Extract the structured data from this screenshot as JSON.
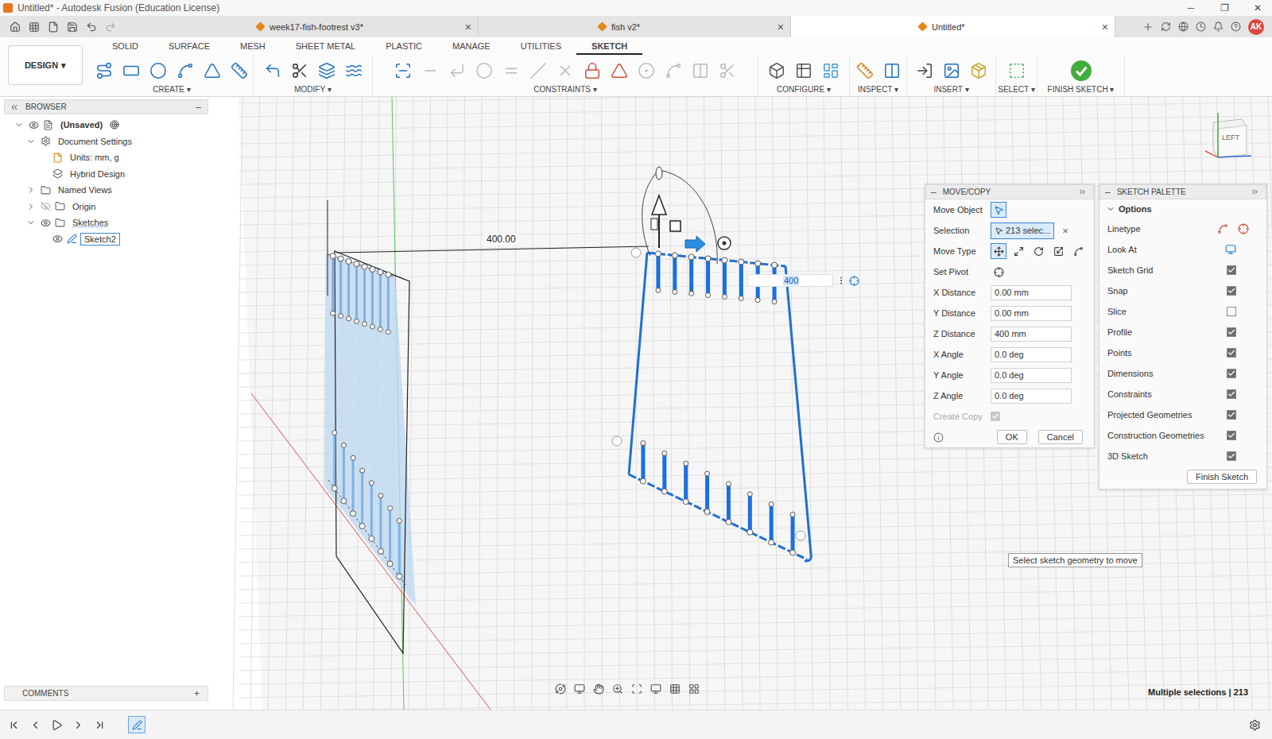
{
  "window": {
    "title": "Untitled* - Autodesk Fusion (Education License)",
    "controls": [
      "─",
      "❐",
      "✕"
    ]
  },
  "doc_tabs": [
    {
      "label": "week17-fish-footrest v3*",
      "selected": false
    },
    {
      "label": "fish v2*",
      "selected": false
    },
    {
      "label": "Untitled*",
      "selected": true
    }
  ],
  "tab_close": "×",
  "account": "AK",
  "workspace": {
    "label": "DESIGN",
    "arrow": "▾"
  },
  "ribbon_tabs": [
    {
      "label": "SOLID",
      "selected": false
    },
    {
      "label": "SURFACE",
      "selected": false
    },
    {
      "label": "MESH",
      "selected": false
    },
    {
      "label": "SHEET METAL",
      "selected": false
    },
    {
      "label": "PLASTIC",
      "selected": false
    },
    {
      "label": "MANAGE",
      "selected": false
    },
    {
      "label": "UTILITIES",
      "selected": false
    },
    {
      "label": "SKETCH",
      "selected": true
    }
  ],
  "ribbon_groups": [
    {
      "label": "CREATE"
    },
    {
      "label": "MODIFY"
    },
    {
      "label": "CONSTRAINTS"
    },
    {
      "label": "CONFIGURE"
    },
    {
      "label": "INSPECT"
    },
    {
      "label": "INSERT"
    },
    {
      "label": "SELECT"
    },
    {
      "label": "FINISH SKETCH"
    }
  ],
  "browser": {
    "title": "BROWSER",
    "collapse": "–",
    "items": [
      {
        "label": "(Unsaved)",
        "depth": 0,
        "toggle": true,
        "expanded": true,
        "visibility": "shown",
        "kind": "document",
        "selected": false,
        "active": false
      },
      {
        "label": "Document Settings",
        "depth": 1,
        "toggle": true,
        "expanded": true,
        "visibility": "none",
        "kind": "settings",
        "selected": false,
        "active": false
      },
      {
        "label": "Units: mm, g",
        "depth": 2,
        "toggle": false,
        "expanded": false,
        "visibility": "none",
        "kind": "units",
        "selected": false,
        "active": false
      },
      {
        "label": "Hybrid Design",
        "depth": 2,
        "toggle": false,
        "expanded": false,
        "visibility": "none",
        "kind": "design",
        "selected": false,
        "active": false
      },
      {
        "label": "Named Views",
        "depth": 1,
        "toggle": true,
        "expanded": false,
        "visibility": "none",
        "kind": "folder",
        "selected": false,
        "active": false
      },
      {
        "label": "Origin",
        "depth": 1,
        "toggle": true,
        "expanded": false,
        "visibility": "hidden",
        "kind": "folder",
        "selected": false,
        "active": false
      },
      {
        "label": "Sketches",
        "depth": 1,
        "toggle": true,
        "expanded": true,
        "visibility": "shown",
        "kind": "folder",
        "selected": false,
        "active": true
      },
      {
        "label": "Sketch2",
        "depth": 2,
        "toggle": false,
        "expanded": false,
        "visibility": "shown",
        "kind": "sketch",
        "selected": true,
        "active": false
      }
    ]
  },
  "canvas": {
    "dimension": "400.00",
    "input": "400",
    "view_cube": "LEFT",
    "tooltip": "Select sketch geometry to move",
    "status": "Multiple selections | 213"
  },
  "move_copy": {
    "title": "MOVE/COPY",
    "collapse": "–",
    "rows": [
      {
        "label": "Move Object",
        "kind": "picker"
      },
      {
        "label": "Selection",
        "kind": "selection",
        "value": "213 selec...",
        "clear": "×"
      },
      {
        "label": "Move Type",
        "kind": "types",
        "options": [
          {
            "selected": true
          },
          {
            "selected": false
          },
          {
            "selected": false
          },
          {
            "selected": false
          },
          {
            "selected": false
          }
        ]
      },
      {
        "label": "Set Pivot",
        "kind": "pivot"
      },
      {
        "label": "X Distance",
        "kind": "field",
        "value": "0.00 mm"
      },
      {
        "label": "Y Distance",
        "kind": "field",
        "value": "0.00 mm"
      },
      {
        "label": "Z Distance",
        "kind": "field",
        "value": "400 mm"
      },
      {
        "label": "X Angle",
        "kind": "field",
        "value": "0.0 deg"
      },
      {
        "label": "Y Angle",
        "kind": "field",
        "value": "0.0 deg"
      },
      {
        "label": "Z Angle",
        "kind": "field",
        "value": "0.0 deg"
      },
      {
        "label": "Create Copy",
        "kind": "checkbox",
        "checked": true,
        "disabled": true
      }
    ],
    "buttons": [
      "OK",
      "Cancel"
    ]
  },
  "sketch_palette": {
    "title": "SKETCH PALETTE",
    "section": {
      "label": "Options",
      "expanded": true
    },
    "rows": [
      {
        "label": "Linetype",
        "kind": "linetype"
      },
      {
        "label": "Look At",
        "kind": "lookat"
      },
      {
        "label": "Sketch Grid",
        "kind": "checkbox",
        "checked": true
      },
      {
        "label": "Snap",
        "kind": "checkbox",
        "checked": true
      },
      {
        "label": "Slice",
        "kind": "checkbox",
        "checked": false
      },
      {
        "label": "Profile",
        "kind": "checkbox",
        "checked": true
      },
      {
        "label": "Points",
        "kind": "checkbox",
        "checked": true
      },
      {
        "label": "Dimensions",
        "kind": "checkbox",
        "checked": true
      },
      {
        "label": "Constraints",
        "kind": "checkbox",
        "checked": true
      },
      {
        "label": "Projected Geometries",
        "kind": "checkbox",
        "checked": true
      },
      {
        "label": "Construction Geometries",
        "kind": "checkbox",
        "checked": true
      },
      {
        "label": "3D Sketch",
        "kind": "checkbox",
        "checked": true
      }
    ],
    "button": "Finish Sketch"
  },
  "comments": {
    "label": "COMMENTS",
    "add": "+"
  }
}
